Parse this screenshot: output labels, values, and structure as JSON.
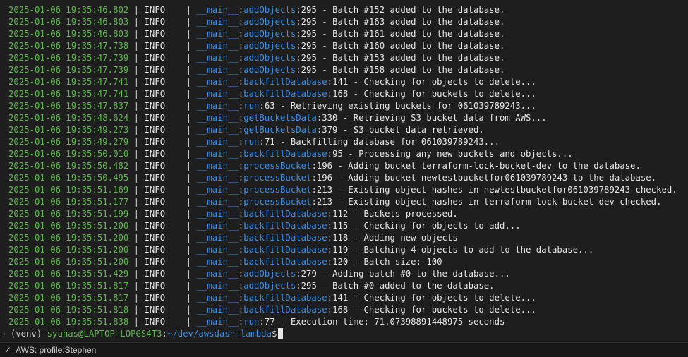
{
  "logs": [
    {
      "ts": "2025-01-06 19:35:46.802",
      "level": "INFO",
      "module": "__main__",
      "func": "addObjects",
      "line": "295",
      "message": "Batch #152 added to the database."
    },
    {
      "ts": "2025-01-06 19:35:46.803",
      "level": "INFO",
      "module": "__main__",
      "func": "addObjects",
      "line": "295",
      "message": "Batch #163 added to the database."
    },
    {
      "ts": "2025-01-06 19:35:46.803",
      "level": "INFO",
      "module": "__main__",
      "func": "addObjects",
      "line": "295",
      "message": "Batch #161 added to the database."
    },
    {
      "ts": "2025-01-06 19:35:47.738",
      "level": "INFO",
      "module": "__main__",
      "func": "addObjects",
      "line": "295",
      "message": "Batch #160 added to the database."
    },
    {
      "ts": "2025-01-06 19:35:47.739",
      "level": "INFO",
      "module": "__main__",
      "func": "addObjects",
      "line": "295",
      "message": "Batch #153 added to the database."
    },
    {
      "ts": "2025-01-06 19:35:47.739",
      "level": "INFO",
      "module": "__main__",
      "func": "addObjects",
      "line": "295",
      "message": "Batch #158 added to the database."
    },
    {
      "ts": "2025-01-06 19:35:47.741",
      "level": "INFO",
      "module": "__main__",
      "func": "backfillDatabase",
      "line": "141",
      "message": "Checking for objects to delete..."
    },
    {
      "ts": "2025-01-06 19:35:47.741",
      "level": "INFO",
      "module": "__main__",
      "func": "backfillDatabase",
      "line": "168",
      "message": "Checking for buckets to delete..."
    },
    {
      "ts": "2025-01-06 19:35:47.837",
      "level": "INFO",
      "module": "__main__",
      "func": "run",
      "line": "63",
      "message": "Retrieving existing buckets for 061039789243..."
    },
    {
      "ts": "2025-01-06 19:35:48.624",
      "level": "INFO",
      "module": "__main__",
      "func": "getBucketsData",
      "line": "330",
      "message": "Retrieving S3 bucket data from AWS..."
    },
    {
      "ts": "2025-01-06 19:35:49.273",
      "level": "INFO",
      "module": "__main__",
      "func": "getBucketsData",
      "line": "379",
      "message": "S3 bucket data retrieved."
    },
    {
      "ts": "2025-01-06 19:35:49.279",
      "level": "INFO",
      "module": "__main__",
      "func": "run",
      "line": "71",
      "message": "Backfilling database for 061039789243..."
    },
    {
      "ts": "2025-01-06 19:35:50.010",
      "level": "INFO",
      "module": "__main__",
      "func": "backfillDatabase",
      "line": "95",
      "message": "Processing any new buckets and objects..."
    },
    {
      "ts": "2025-01-06 19:35:50.482",
      "level": "INFO",
      "module": "__main__",
      "func": "processBucket",
      "line": "196",
      "message": "Adding bucket terraform-lock-bucket-dev to the database."
    },
    {
      "ts": "2025-01-06 19:35:50.495",
      "level": "INFO",
      "module": "__main__",
      "func": "processBucket",
      "line": "196",
      "message": "Adding bucket newtestbucketfor061039789243 to the database."
    },
    {
      "ts": "2025-01-06 19:35:51.169",
      "level": "INFO",
      "module": "__main__",
      "func": "processBucket",
      "line": "213",
      "message": "Existing object hashes in newtestbucketfor061039789243 checked."
    },
    {
      "ts": "2025-01-06 19:35:51.177",
      "level": "INFO",
      "module": "__main__",
      "func": "processBucket",
      "line": "213",
      "message": "Existing object hashes in terraform-lock-bucket-dev checked."
    },
    {
      "ts": "2025-01-06 19:35:51.199",
      "level": "INFO",
      "module": "__main__",
      "func": "backfillDatabase",
      "line": "112",
      "message": "Buckets processed."
    },
    {
      "ts": "2025-01-06 19:35:51.200",
      "level": "INFO",
      "module": "__main__",
      "func": "backfillDatabase",
      "line": "115",
      "message": "Checking for objects to add..."
    },
    {
      "ts": "2025-01-06 19:35:51.200",
      "level": "INFO",
      "module": "__main__",
      "func": "backfillDatabase",
      "line": "118",
      "message": "Adding new objects"
    },
    {
      "ts": "2025-01-06 19:35:51.200",
      "level": "INFO",
      "module": "__main__",
      "func": "backfillDatabase",
      "line": "119",
      "message": "Batching 4 objects to add to the database..."
    },
    {
      "ts": "2025-01-06 19:35:51.200",
      "level": "INFO",
      "module": "__main__",
      "func": "backfillDatabase",
      "line": "120",
      "message": "Batch size: 100"
    },
    {
      "ts": "2025-01-06 19:35:51.429",
      "level": "INFO",
      "module": "__main__",
      "func": "addObjects",
      "line": "279",
      "message": "Adding batch #0 to the database..."
    },
    {
      "ts": "2025-01-06 19:35:51.817",
      "level": "INFO",
      "module": "__main__",
      "func": "addObjects",
      "line": "295",
      "message": "Batch #0 added to the database."
    },
    {
      "ts": "2025-01-06 19:35:51.817",
      "level": "INFO",
      "module": "__main__",
      "func": "backfillDatabase",
      "line": "141",
      "message": "Checking for objects to delete..."
    },
    {
      "ts": "2025-01-06 19:35:51.818",
      "level": "INFO",
      "module": "__main__",
      "func": "backfillDatabase",
      "line": "168",
      "message": "Checking for buckets to delete..."
    },
    {
      "ts": "2025-01-06 19:35:51.838",
      "level": "INFO",
      "module": "__main__",
      "func": "run",
      "line": "77",
      "message": "Execution time: 71.07398891448975 seconds"
    }
  ],
  "prompt": {
    "gutter": "→",
    "venv": "(venv)",
    "user_host": "syuhas@LAPTOP-LOPGS4T3",
    "colon": ":",
    "path": "~/dev/awsdash-lambda",
    "symbol": "$"
  },
  "statusbar": {
    "check_icon": "✓",
    "aws_profile": "AWS: profile:Stephen"
  },
  "colors": {
    "timestamp": "#5fb84f",
    "module": "#3b8eea",
    "background": "#1e1e1e"
  }
}
